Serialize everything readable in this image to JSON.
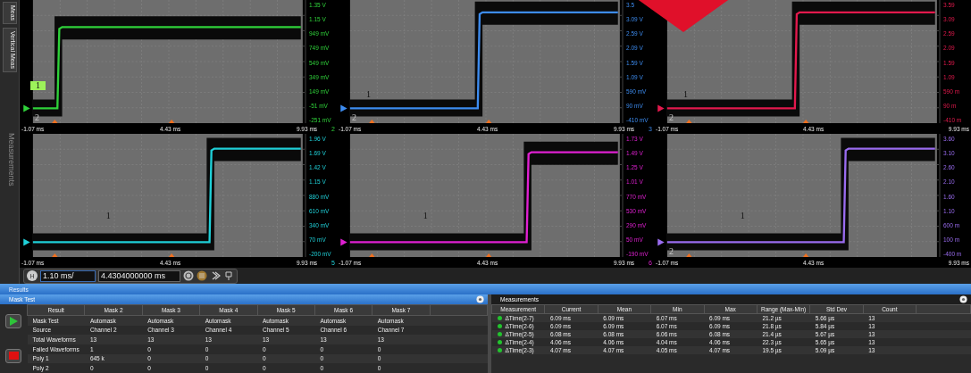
{
  "side_tabs": [
    {
      "label": "Meas",
      "faded": false
    },
    {
      "label": "Vertical Meas",
      "faded": false
    },
    {
      "label": "Measurements",
      "faded": true
    }
  ],
  "panels": [
    {
      "color": "#2fd23a",
      "channel": "2",
      "y_labels": [
        "1.35 V",
        "1.15 V",
        "949 mV",
        "749 mV",
        "549 mV",
        "349 mV",
        "149 mV",
        "-51 mV",
        "-251 mV"
      ],
      "x_labels": [
        "-1.07 ms",
        "4.43 ms",
        "9.93 ms"
      ],
      "markers": [
        {
          "text": "1",
          "highlighted": true
        },
        {
          "text": "2",
          "highlighted": false
        }
      ]
    },
    {
      "color": "#3d8cf0",
      "channel": "3",
      "y_labels": [
        "3.5",
        "3.09 V",
        "2.59 V",
        "2.09 V",
        "1.59 V",
        "1.09 V",
        "590 mV",
        "90 mV",
        "-410 mV"
      ],
      "x_labels": [
        "-1.07 ms",
        "4.43 ms",
        "9.93 ms"
      ],
      "markers": [
        {
          "text": "1",
          "highlighted": false
        },
        {
          "text": "2",
          "highlighted": false
        }
      ]
    },
    {
      "color": "#e3194d",
      "y_labels": [
        "3.59",
        "3.09",
        "2.59",
        "2.09",
        "1.59",
        "1.09",
        "590 m",
        "90 m",
        "-410 m"
      ],
      "x_labels": [
        "-1.07 ms",
        "4.43 ms",
        "9.93 ms"
      ],
      "markers": [
        {
          "text": "1",
          "highlighted": false
        },
        {
          "text": "2",
          "highlighted": false
        }
      ]
    },
    {
      "color": "#1fd0d8",
      "channel": "5",
      "y_labels": [
        "1.96 V",
        "1.69 V",
        "1.42 V",
        "1.15 V",
        "880 mV",
        "610 mV",
        "340 mV",
        "70 mV",
        "-200 mV"
      ],
      "x_labels": [
        "-1.07 ms",
        "4.43 ms",
        "9.93 ms"
      ],
      "markers": [
        {
          "text": "1",
          "highlighted": false
        }
      ]
    },
    {
      "color": "#e020d2",
      "channel": "6",
      "y_labels": [
        "1.73 V",
        "1.49 V",
        "1.25 V",
        "1.01 V",
        "770 mV",
        "530 mV",
        "290 mV",
        "50 mV",
        "-190 mV"
      ],
      "x_labels": [
        "-1.07 ms",
        "4.43 ms",
        "9.93 ms"
      ],
      "markers": [
        {
          "text": "1",
          "highlighted": false
        }
      ]
    },
    {
      "color": "#9a6cf0",
      "y_labels": [
        "3.60",
        "3.10",
        "2.60",
        "2.10",
        "1.60",
        "1.10",
        "600 m",
        "100 m",
        "-400 m"
      ],
      "x_labels": [
        "-1.07 ms",
        "4.43 ms",
        "9.93 ms"
      ],
      "markers": [
        {
          "text": "1",
          "highlighted": false
        },
        {
          "text": "2",
          "highlighted": false
        }
      ]
    }
  ],
  "timebase": {
    "button": "H",
    "scale": "1.10 ms/",
    "position": "4.4304000000 ms"
  },
  "results": {
    "title": "Results",
    "mask_test": {
      "title": "Mask Test",
      "columns": [
        "Result",
        "Mask 2",
        "Mask 3",
        "Mask 4",
        "Mask 5",
        "Mask 6",
        "Mask 7"
      ],
      "rows": [
        [
          "Mask Test",
          "Automask",
          "Automask",
          "Automask",
          "Automask",
          "Automask",
          "Automask"
        ],
        [
          "Source",
          "Channel 2",
          "Channel 3",
          "Channel 4",
          "Channel 5",
          "Channel 6",
          "Channel 7"
        ],
        [
          "Total Waveforms",
          "13",
          "13",
          "13",
          "13",
          "13",
          "13"
        ],
        [
          "Failed Waveforms",
          "1",
          "0",
          "0",
          "0",
          "0",
          "0"
        ],
        [
          "Poly 1",
          "645 k",
          "0",
          "0",
          "0",
          "0",
          "0"
        ],
        [
          "Poly 2",
          "0",
          "0",
          "0",
          "0",
          "0",
          "0"
        ]
      ]
    },
    "measurements": {
      "title": "Measurements",
      "columns": [
        "Measurement",
        "Current",
        "Mean",
        "Min",
        "Max",
        "Range (Max-Min)",
        "Std Dev",
        "Count"
      ],
      "rows": [
        {
          "color": "#22c32e",
          "cells": [
            "ΔTime(2-7)",
            "6.09 ms",
            "6.09 ms",
            "6.07 ms",
            "6.09 ms",
            "21.2 µs",
            "5.66 µs",
            "13"
          ]
        },
        {
          "color": "#22c32e",
          "cells": [
            "ΔTime(2-6)",
            "6.09 ms",
            "6.09 ms",
            "6.07 ms",
            "6.09 ms",
            "21.8 µs",
            "5.84 µs",
            "13"
          ]
        },
        {
          "color": "#22c32e",
          "cells": [
            "ΔTime(2-5)",
            "6.08 ms",
            "6.08 ms",
            "6.06 ms",
            "6.08 ms",
            "21.4 µs",
            "5.67 µs",
            "13"
          ]
        },
        {
          "color": "#22c32e",
          "cells": [
            "ΔTime(2-4)",
            "4.06 ms",
            "4.06 ms",
            "4.04 ms",
            "4.06 ms",
            "22.3 µs",
            "5.65 µs",
            "13"
          ]
        },
        {
          "color": "#22c32e",
          "cells": [
            "ΔTime(2-3)",
            "4.07 ms",
            "4.07 ms",
            "4.05 ms",
            "4.07 ms",
            "19.5 µs",
            "5.09 µs",
            "13"
          ]
        }
      ]
    }
  }
}
